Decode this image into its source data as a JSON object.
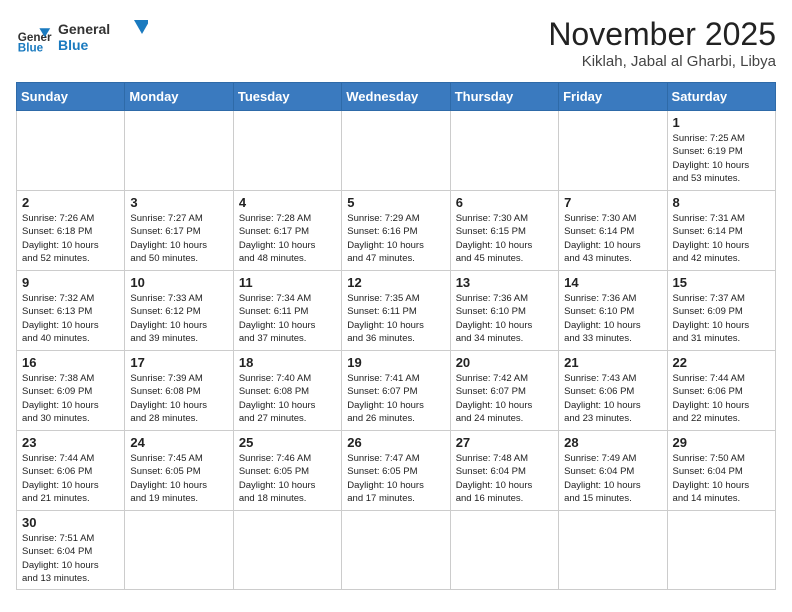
{
  "header": {
    "logo_general": "General",
    "logo_blue": "Blue",
    "month": "November 2025",
    "location": "Kiklah, Jabal al Gharbi, Libya"
  },
  "weekdays": [
    "Sunday",
    "Monday",
    "Tuesday",
    "Wednesday",
    "Thursday",
    "Friday",
    "Saturday"
  ],
  "weeks": [
    [
      {
        "day": "",
        "info": ""
      },
      {
        "day": "",
        "info": ""
      },
      {
        "day": "",
        "info": ""
      },
      {
        "day": "",
        "info": ""
      },
      {
        "day": "",
        "info": ""
      },
      {
        "day": "",
        "info": ""
      },
      {
        "day": "1",
        "info": "Sunrise: 7:25 AM\nSunset: 6:19 PM\nDaylight: 10 hours\nand 53 minutes."
      }
    ],
    [
      {
        "day": "2",
        "info": "Sunrise: 7:26 AM\nSunset: 6:18 PM\nDaylight: 10 hours\nand 52 minutes."
      },
      {
        "day": "3",
        "info": "Sunrise: 7:27 AM\nSunset: 6:17 PM\nDaylight: 10 hours\nand 50 minutes."
      },
      {
        "day": "4",
        "info": "Sunrise: 7:28 AM\nSunset: 6:17 PM\nDaylight: 10 hours\nand 48 minutes."
      },
      {
        "day": "5",
        "info": "Sunrise: 7:29 AM\nSunset: 6:16 PM\nDaylight: 10 hours\nand 47 minutes."
      },
      {
        "day": "6",
        "info": "Sunrise: 7:30 AM\nSunset: 6:15 PM\nDaylight: 10 hours\nand 45 minutes."
      },
      {
        "day": "7",
        "info": "Sunrise: 7:30 AM\nSunset: 6:14 PM\nDaylight: 10 hours\nand 43 minutes."
      },
      {
        "day": "8",
        "info": "Sunrise: 7:31 AM\nSunset: 6:14 PM\nDaylight: 10 hours\nand 42 minutes."
      }
    ],
    [
      {
        "day": "9",
        "info": "Sunrise: 7:32 AM\nSunset: 6:13 PM\nDaylight: 10 hours\nand 40 minutes."
      },
      {
        "day": "10",
        "info": "Sunrise: 7:33 AM\nSunset: 6:12 PM\nDaylight: 10 hours\nand 39 minutes."
      },
      {
        "day": "11",
        "info": "Sunrise: 7:34 AM\nSunset: 6:11 PM\nDaylight: 10 hours\nand 37 minutes."
      },
      {
        "day": "12",
        "info": "Sunrise: 7:35 AM\nSunset: 6:11 PM\nDaylight: 10 hours\nand 36 minutes."
      },
      {
        "day": "13",
        "info": "Sunrise: 7:36 AM\nSunset: 6:10 PM\nDaylight: 10 hours\nand 34 minutes."
      },
      {
        "day": "14",
        "info": "Sunrise: 7:36 AM\nSunset: 6:10 PM\nDaylight: 10 hours\nand 33 minutes."
      },
      {
        "day": "15",
        "info": "Sunrise: 7:37 AM\nSunset: 6:09 PM\nDaylight: 10 hours\nand 31 minutes."
      }
    ],
    [
      {
        "day": "16",
        "info": "Sunrise: 7:38 AM\nSunset: 6:09 PM\nDaylight: 10 hours\nand 30 minutes."
      },
      {
        "day": "17",
        "info": "Sunrise: 7:39 AM\nSunset: 6:08 PM\nDaylight: 10 hours\nand 28 minutes."
      },
      {
        "day": "18",
        "info": "Sunrise: 7:40 AM\nSunset: 6:08 PM\nDaylight: 10 hours\nand 27 minutes."
      },
      {
        "day": "19",
        "info": "Sunrise: 7:41 AM\nSunset: 6:07 PM\nDaylight: 10 hours\nand 26 minutes."
      },
      {
        "day": "20",
        "info": "Sunrise: 7:42 AM\nSunset: 6:07 PM\nDaylight: 10 hours\nand 24 minutes."
      },
      {
        "day": "21",
        "info": "Sunrise: 7:43 AM\nSunset: 6:06 PM\nDaylight: 10 hours\nand 23 minutes."
      },
      {
        "day": "22",
        "info": "Sunrise: 7:44 AM\nSunset: 6:06 PM\nDaylight: 10 hours\nand 22 minutes."
      }
    ],
    [
      {
        "day": "23",
        "info": "Sunrise: 7:44 AM\nSunset: 6:06 PM\nDaylight: 10 hours\nand 21 minutes."
      },
      {
        "day": "24",
        "info": "Sunrise: 7:45 AM\nSunset: 6:05 PM\nDaylight: 10 hours\nand 19 minutes."
      },
      {
        "day": "25",
        "info": "Sunrise: 7:46 AM\nSunset: 6:05 PM\nDaylight: 10 hours\nand 18 minutes."
      },
      {
        "day": "26",
        "info": "Sunrise: 7:47 AM\nSunset: 6:05 PM\nDaylight: 10 hours\nand 17 minutes."
      },
      {
        "day": "27",
        "info": "Sunrise: 7:48 AM\nSunset: 6:04 PM\nDaylight: 10 hours\nand 16 minutes."
      },
      {
        "day": "28",
        "info": "Sunrise: 7:49 AM\nSunset: 6:04 PM\nDaylight: 10 hours\nand 15 minutes."
      },
      {
        "day": "29",
        "info": "Sunrise: 7:50 AM\nSunset: 6:04 PM\nDaylight: 10 hours\nand 14 minutes."
      }
    ],
    [
      {
        "day": "30",
        "info": "Sunrise: 7:51 AM\nSunset: 6:04 PM\nDaylight: 10 hours\nand 13 minutes."
      },
      {
        "day": "",
        "info": ""
      },
      {
        "day": "",
        "info": ""
      },
      {
        "day": "",
        "info": ""
      },
      {
        "day": "",
        "info": ""
      },
      {
        "day": "",
        "info": ""
      },
      {
        "day": "",
        "info": ""
      }
    ]
  ]
}
